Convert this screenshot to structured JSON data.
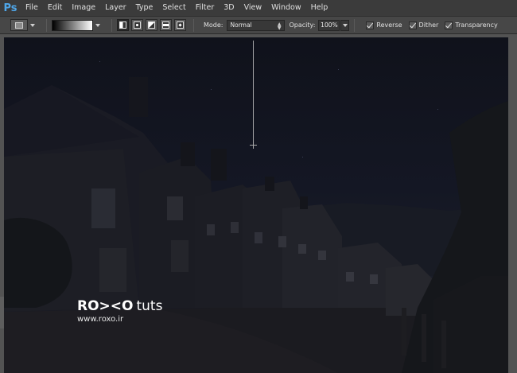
{
  "app": {
    "logo": "Ps"
  },
  "menu": [
    "File",
    "Edit",
    "Image",
    "Layer",
    "Type",
    "Select",
    "Filter",
    "3D",
    "View",
    "Window",
    "Help"
  ],
  "options": {
    "gradient_types": [
      "linear-gradient-icon",
      "radial-gradient-icon",
      "angle-gradient-icon",
      "reflected-gradient-icon",
      "diamond-gradient-icon"
    ],
    "mode_label": "Mode:",
    "mode_value": "Normal",
    "opacity_label": "Opacity:",
    "opacity_value": "100%",
    "reverse_label": "Reverse",
    "reverse_checked": true,
    "dither_label": "Dither",
    "dither_checked": true,
    "transparency_label": "Transparency",
    "transparency_checked": true
  },
  "canvas": {
    "watermark_brand": "RO><O",
    "watermark_suffix": "tuts",
    "watermark_url": "www.roxo.ir"
  },
  "colors": {
    "menubar_bg": "#3b3b3b",
    "options_bg": "#474747",
    "workspace_bg": "#535353",
    "ps_logo": "#4fa6e8"
  }
}
